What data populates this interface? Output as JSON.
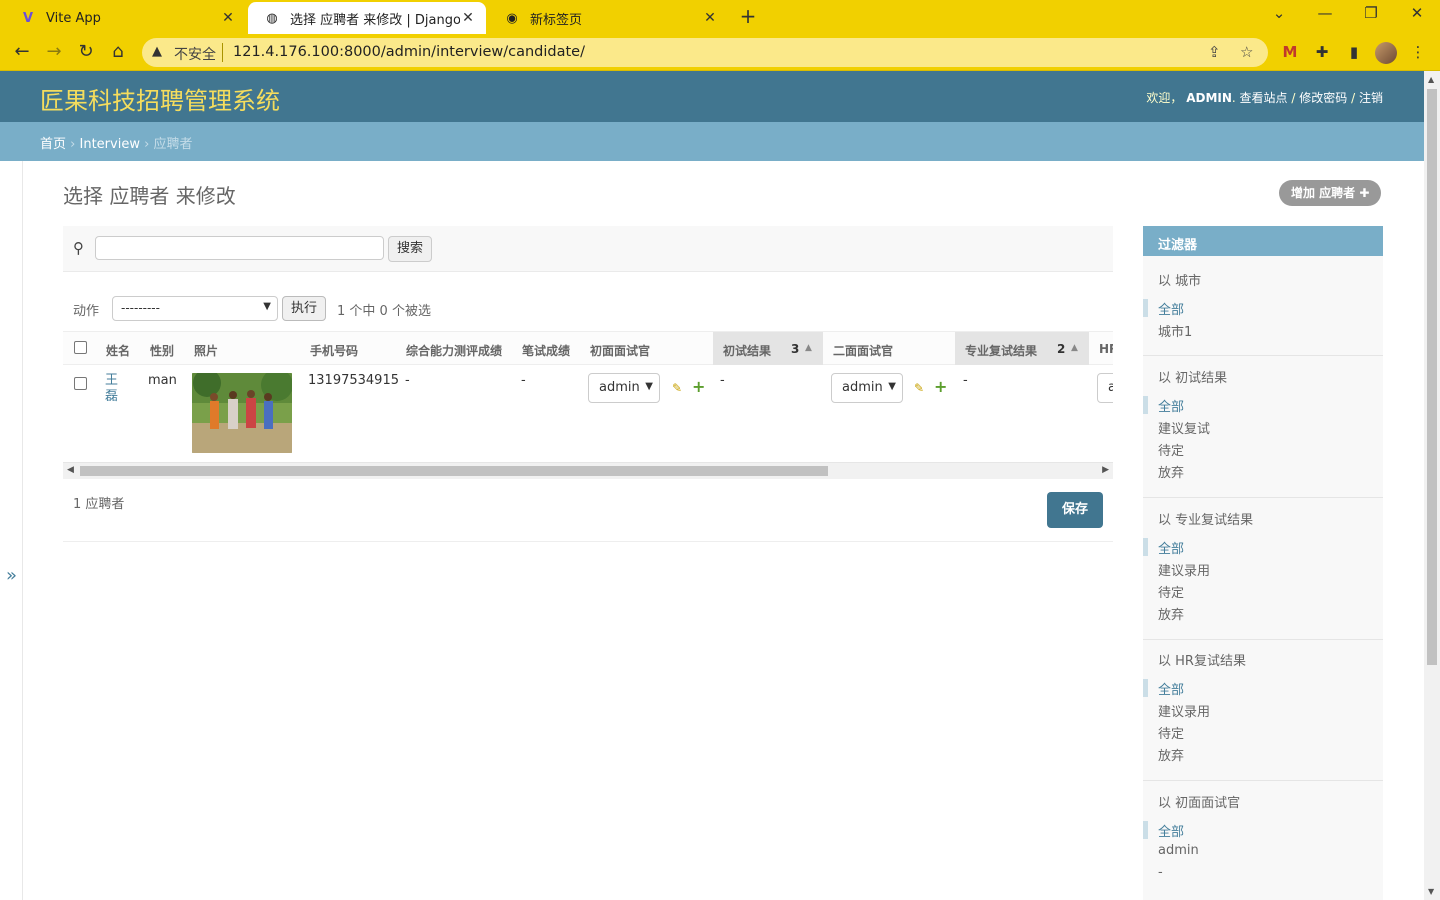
{
  "browser": {
    "tabs": [
      {
        "title": "Vite App",
        "icon": "vite-icon"
      },
      {
        "title": "选择 应聘者 来修改 | Django 站点",
        "icon": "globe-icon"
      },
      {
        "title": "新标签页",
        "icon": "chrome-icon"
      }
    ],
    "insecure_label": "不安全",
    "url": "121.4.176.100:8000/admin/interview/candidate/"
  },
  "header": {
    "site_title": "匠果科技招聘管理系统",
    "welcome": "欢迎，",
    "username": "ADMIN",
    "view_site": "查看站点",
    "change_password": "修改密码",
    "logout": "注销",
    "sep": "/"
  },
  "breadcrumbs": {
    "home": "首页",
    "app": "Interview",
    "current": "应聘者",
    "sep": "›"
  },
  "main": {
    "title": "选择 应聘者 来修改",
    "add_button": "增加 应聘者",
    "search_button": "搜索",
    "action_label": "动作",
    "action_selected": "---------",
    "go_button": "执行",
    "selection_counter": "1 个中 0 个被选",
    "result_count": "1 应聘者",
    "save_button": "保存",
    "sidebar_toggle": "»"
  },
  "table": {
    "headers": {
      "name": "姓名",
      "gender": "性别",
      "photo": "照片",
      "phone": "手机号码",
      "test_score": "综合能力测评成绩",
      "paper_score": "笔试成绩",
      "first_interviewer": "初面面试官",
      "first_result": "初试结果",
      "first_result_sort": "3",
      "second_interviewer": "二面面试官",
      "second_result": "专业复试结果",
      "second_result_sort": "2",
      "hr": "HR"
    },
    "rows": [
      {
        "name_line1": "王",
        "name_line2": "磊",
        "gender": "man",
        "phone": "13197534915",
        "test_score": "-",
        "paper_score": "-",
        "first_interviewer": "admin",
        "first_result": "-",
        "second_interviewer": "admin",
        "second_result": "-",
        "hr_partial": "a"
      }
    ]
  },
  "filter": {
    "title": "过滤器",
    "groups": [
      {
        "heading": "以 城市",
        "items": [
          "全部",
          "城市1"
        ]
      },
      {
        "heading": "以 初试结果",
        "items": [
          "全部",
          "建议复试",
          "待定",
          "放弃"
        ]
      },
      {
        "heading": "以 专业复试结果",
        "items": [
          "全部",
          "建议录用",
          "待定",
          "放弃"
        ]
      },
      {
        "heading": "以 HR复试结果",
        "items": [
          "全部",
          "建议录用",
          "待定",
          "放弃"
        ]
      },
      {
        "heading": "以 初面面试官",
        "items": [
          "全部",
          "admin",
          "-"
        ]
      }
    ]
  },
  "colors": {
    "header": "#417690",
    "breadcrumbs": "#79aec8",
    "title": "#f5dd5d",
    "chrome": "#f1d000"
  }
}
